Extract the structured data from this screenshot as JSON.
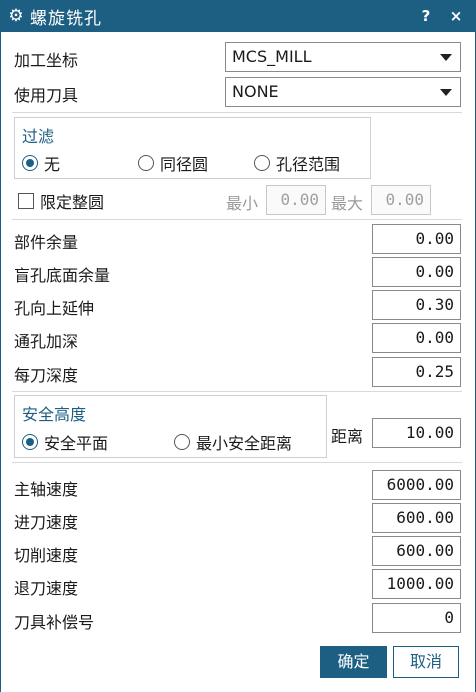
{
  "window": {
    "title": "螺旋铣孔",
    "help": "?",
    "close": "×"
  },
  "coord": {
    "label": "加工坐标",
    "value": "MCS_MILL"
  },
  "tool": {
    "label": "使用刀具",
    "value": "NONE"
  },
  "filter": {
    "title": "过滤",
    "options": [
      "无",
      "同径圆",
      "孔径范围"
    ],
    "selected": "无"
  },
  "limit": {
    "label": "限定整圆",
    "min_label": "最小",
    "min_value": "0.00",
    "max_label": "最大",
    "max_value": "0.00"
  },
  "params": [
    {
      "label": "部件余量",
      "value": "0.00"
    },
    {
      "label": "盲孔底面余量",
      "value": "0.00"
    },
    {
      "label": "孔向上延伸",
      "value": "0.30"
    },
    {
      "label": "通孔加深",
      "value": "0.00"
    },
    {
      "label": "每刀深度",
      "value": "0.25"
    }
  ],
  "safety": {
    "title": "安全高度",
    "options": [
      "安全平面",
      "最小安全距离"
    ],
    "selected": "安全平面",
    "distance_label": "距离",
    "distance_value": "10.00"
  },
  "speeds": [
    {
      "label": "主轴速度",
      "value": "6000.00"
    },
    {
      "label": "进刀速度",
      "value": "600.00"
    },
    {
      "label": "切削速度",
      "value": "600.00"
    },
    {
      "label": "退刀速度",
      "value": "1000.00"
    },
    {
      "label": "刀具补偿号",
      "value": "0"
    }
  ],
  "buttons": {
    "ok": "确定",
    "cancel": "取消"
  }
}
